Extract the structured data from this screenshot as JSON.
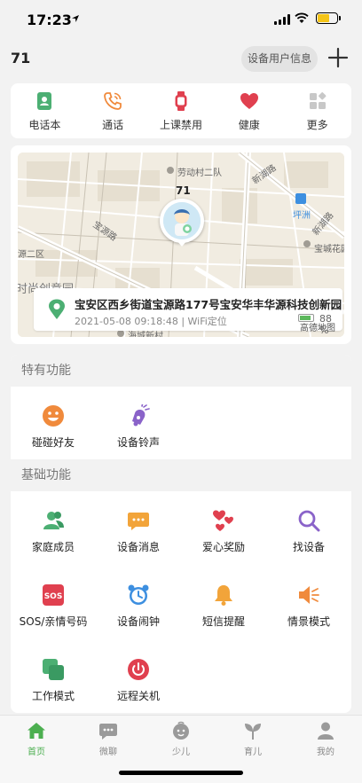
{
  "status_bar": {
    "time": "17:23"
  },
  "header": {
    "device_name": "71",
    "device_info_label": "设备用户信息"
  },
  "quick_actions": [
    {
      "label": "电话本",
      "icon": "phonebook-icon"
    },
    {
      "label": "通话",
      "icon": "phone-call-icon"
    },
    {
      "label": "上课禁用",
      "icon": "watch-icon"
    },
    {
      "label": "健康",
      "icon": "heart-icon"
    },
    {
      "label": "更多",
      "icon": "more-grid-icon"
    }
  ],
  "map": {
    "marker_name": "71",
    "labels": {
      "laodong": "劳动村二队",
      "xinhu_1": "新湖路",
      "xinhu_2": "新湖路",
      "baoyuan": "宝源路",
      "pingzhou": "坪洲",
      "baocheng": "宝城花园",
      "erqu": "源二区",
      "chuangyi": "时尚创意园",
      "haicheng": "海城新村"
    },
    "address": "宝安区西乡街道宝源路177号宝安华丰华源科技创新园",
    "updated_at": "2021-05-08 09:18:48 | WiFi定位",
    "battery_text": "88 %",
    "battery_level": 0.88,
    "watermark": "高德地图"
  },
  "special_section": {
    "title": "特有功能",
    "items": [
      {
        "label": "碰碰好友",
        "icon": "smile-icon"
      },
      {
        "label": "设备铃声",
        "icon": "bell-ring-icon"
      }
    ]
  },
  "basic_section": {
    "title": "基础功能",
    "items": [
      {
        "label": "家庭成员",
        "icon": "family-icon"
      },
      {
        "label": "设备消息",
        "icon": "message-icon"
      },
      {
        "label": "爱心奖励",
        "icon": "hearts-icon"
      },
      {
        "label": "找设备",
        "icon": "search-icon"
      },
      {
        "label": "SOS/亲情号码",
        "icon": "sos-icon"
      },
      {
        "label": "设备闹钟",
        "icon": "alarm-clock-icon"
      },
      {
        "label": "短信提醒",
        "icon": "bell-icon"
      },
      {
        "label": "情景模式",
        "icon": "speaker-icon"
      },
      {
        "label": "工作模式",
        "icon": "layers-icon"
      },
      {
        "label": "远程关机",
        "icon": "power-icon"
      }
    ]
  },
  "tabbar": {
    "tabs": [
      {
        "label": "首页",
        "icon": "home-icon",
        "active": true
      },
      {
        "label": "微聊",
        "icon": "chat-icon",
        "active": false
      },
      {
        "label": "少儿",
        "icon": "child-icon",
        "active": false
      },
      {
        "label": "育儿",
        "icon": "sprout-icon",
        "active": false
      },
      {
        "label": "我的",
        "icon": "profile-icon",
        "active": false
      }
    ]
  },
  "colors": {
    "accent": "#4caf50",
    "orange": "#f08a3c",
    "red": "#e0404f",
    "purple": "#8a63c9",
    "blue": "#3d8fe0"
  }
}
